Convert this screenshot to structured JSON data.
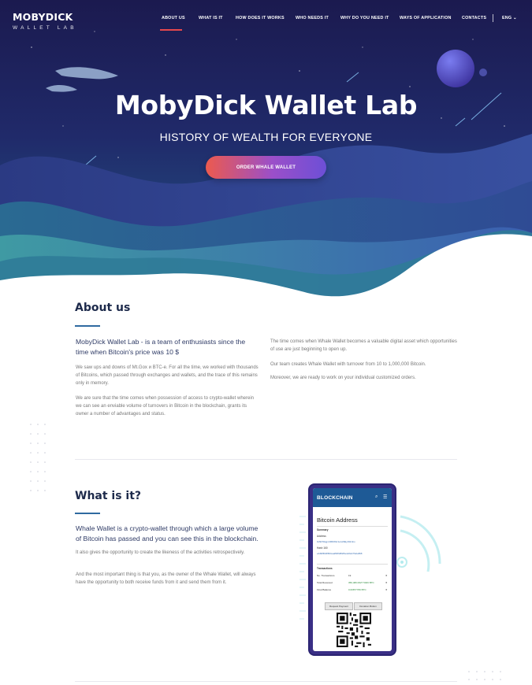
{
  "brand": {
    "name": "MOBYDICK",
    "tagline": "WALLET LAB"
  },
  "nav": {
    "items": [
      "ABOUT US",
      "WHAT IS IT",
      "HOW DOES IT WORKS",
      "WHO NEEDS IT",
      "WHY DO YOU NEED IT",
      "WAYS OF APPLICATION",
      "CONTACTS"
    ],
    "active": "ABOUT US",
    "language": "ENG"
  },
  "hero": {
    "title": "MobyDick Wallet Lab",
    "subtitle": "HISTORY OF WEALTH FOR EVERYONE",
    "cta": "ORDER WHALE WALLET"
  },
  "about": {
    "title": "About us",
    "lead": "MobyDick Wallet Lab - is a team of enthusiasts since the time when Bitcoin's price was 10 $",
    "left_paragraphs": [
      "We saw ups and downs of Mt.Gox и BTC-e. For all the time, we worked with thousands of Bitcoins, which passed through exchanges and wallets, and the trace of this remains only in memory.",
      "We are sure that the time comes when possession of access to crypto-wallet wherein we can see an enviable volume of turnovers in Bitcoin in the blockchain, grants its owner a number of advantages and status."
    ],
    "right_paragraphs": [
      "The time comes when Whale Wallet becomes a valuable digital asset which opportunities of use are just beginning to open up.",
      "Our team creates Whale Wallet with turnover from 10 to 1,000,000 Bitcoin.",
      "Moreover, we are ready to work on your individual customized orders."
    ]
  },
  "what": {
    "title": "What is it?",
    "lead": "Whale Wallet is a crypto-wallet through which a large volume of Bitcoin has passed and you can see this in the blockchain.",
    "paragraphs": [
      "It also gives the opportunity to create the likeness of the activities retrospectively.",
      "And the most important thing is that you, as the owner of the Whale Wallet, will always have the opportunity to both receive funds from it and send them from it."
    ]
  },
  "phone": {
    "app_title": "BLOCKCHAIN",
    "screen_title": "Bitcoin Address",
    "summary_label": "Summary",
    "address_label": "Address",
    "address_value": "1MkOWqgnUMDWkz1ezwMEyAWmbu",
    "hash_label": "Hash 160",
    "hash_value": "e4d98f6d0f8fdcaa8bf8d80d5edef0ebf7aba898",
    "transactions_label": "Transactions",
    "rows": [
      {
        "label": "No. Transactions",
        "value": "19"
      },
      {
        "label": "Total Received",
        "value": "350,480.0627 5026 BTC"
      },
      {
        "label": "Final Balance",
        "value": "0.00877766 BTC"
      }
    ],
    "buttons": [
      "Request Payment",
      "Donation Button"
    ]
  },
  "colors": {
    "hero_top": "#1c1c55",
    "hero_mid": "#233a7a",
    "wave_teal": "#2c7a9a",
    "accent_red": "#e5484d",
    "heading": "#1d2a4b",
    "title_bar": "#2f6aa0"
  }
}
